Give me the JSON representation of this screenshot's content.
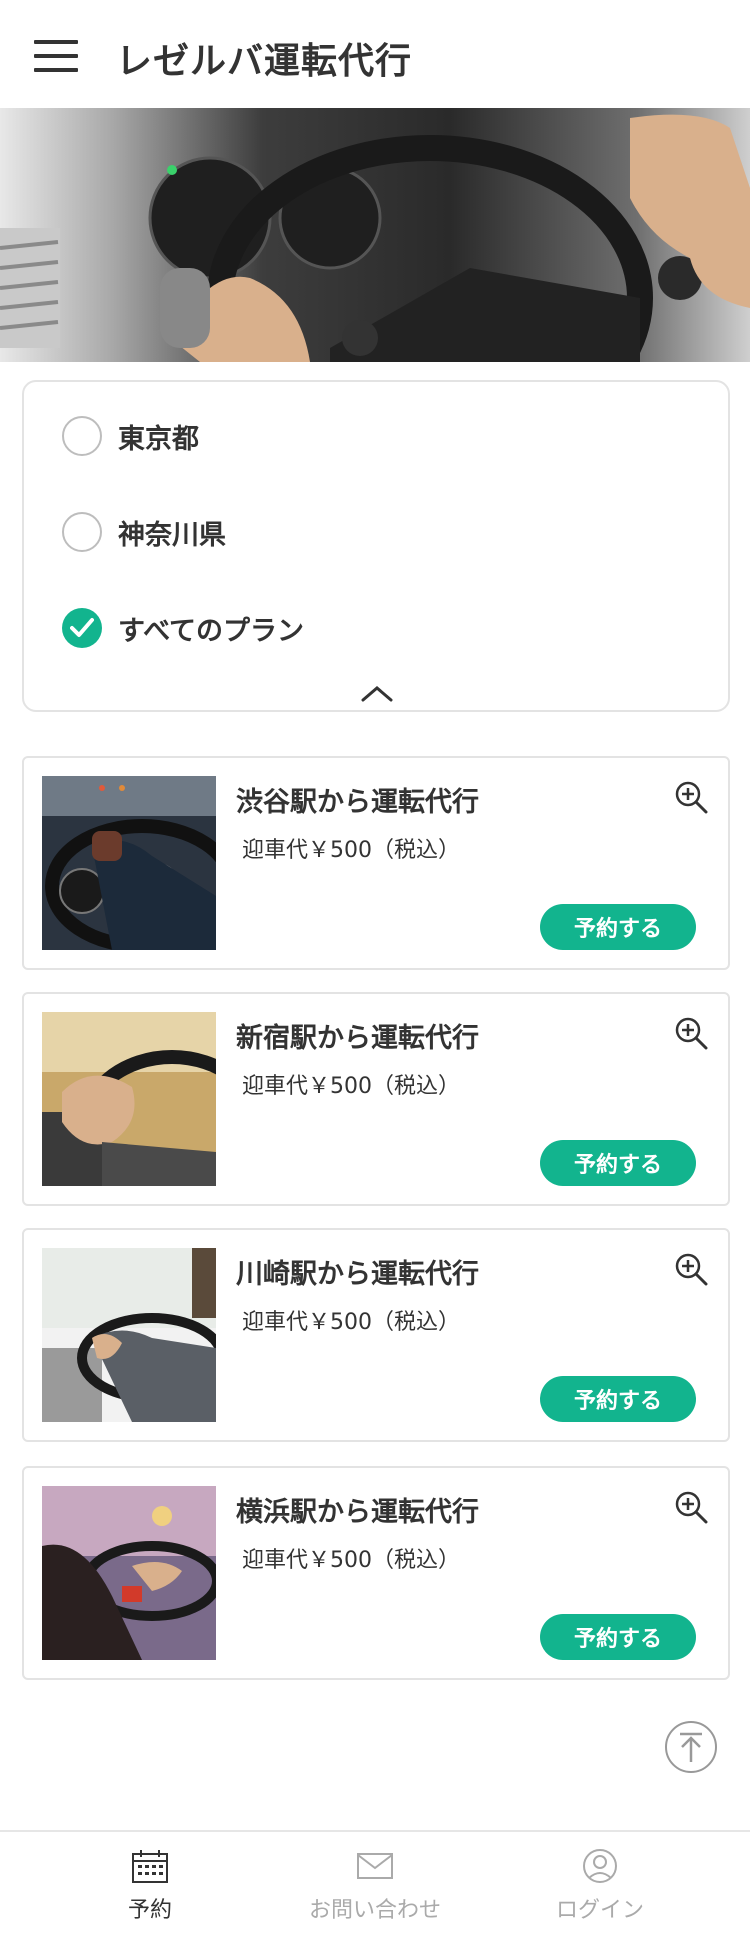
{
  "header": {
    "title": "レゼルバ運転代行",
    "menu_icon": "hamburger-menu-icon"
  },
  "filter": {
    "options": [
      {
        "label": "東京都",
        "checked": false
      },
      {
        "label": "神奈川県",
        "checked": false
      },
      {
        "label": "すべてのプラン",
        "checked": true
      }
    ],
    "collapse_icon": "chevron-up-icon"
  },
  "plans": [
    {
      "title": "渋谷駅から運転代行",
      "fee": "迎車代￥500（税込）",
      "button": "予約する"
    },
    {
      "title": "新宿駅から運転代行",
      "fee": "迎車代￥500（税込）",
      "button": "予約する"
    },
    {
      "title": "川崎駅から運転代行",
      "fee": "迎車代￥500（税込）",
      "button": "予約する"
    },
    {
      "title": "横浜駅から運転代行",
      "fee": "迎車代￥500（税込）",
      "button": "予約する"
    }
  ],
  "bottom_nav": {
    "items": [
      {
        "label": "予約",
        "icon": "calendar-icon",
        "active": true
      },
      {
        "label": "お問い合わせ",
        "icon": "mail-icon",
        "active": false
      },
      {
        "label": "ログイン",
        "icon": "user-icon",
        "active": false
      }
    ]
  },
  "colors": {
    "accent": "#12b48e",
    "text": "#333333",
    "border": "#e3e3e3",
    "inactive": "#aaaaaa"
  }
}
